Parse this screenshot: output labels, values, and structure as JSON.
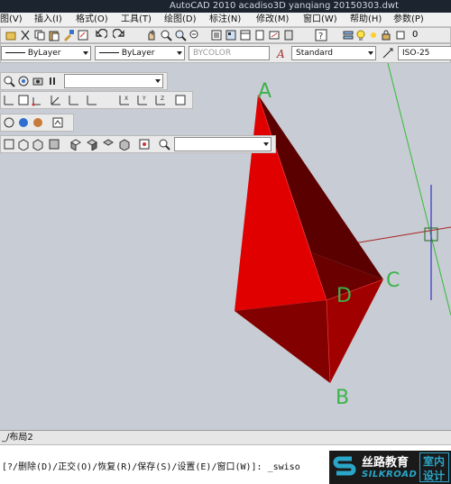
{
  "titlebar": {
    "title": "AutoCAD 2010    acadiso3D  yanqiang 20150303.dwt"
  },
  "menu": [
    "图(V)",
    "插入(I)",
    "格式(O)",
    "工具(T)",
    "绘图(D)",
    "标注(N)",
    "修改(M)",
    "窗口(W)",
    "帮助(H)",
    "参数(P)"
  ],
  "properties": {
    "linetype": "ByLayer",
    "lineweight": "ByLayer",
    "color": "BYCOLOR",
    "text_style": "Standard",
    "dim_style": "ISO-25",
    "layer_value": "0"
  },
  "points": {
    "a": "A",
    "b": "B",
    "c": "C",
    "d": "D"
  },
  "colors": {
    "face_light": "#e00000",
    "face_mid": "#a00000",
    "face_dark": "#6a0000",
    "label": "#3cb34a",
    "axis_y": "#3333cc",
    "axis_z": "#33bb33"
  },
  "tabs": {
    "layout2": "_/布局2"
  },
  "command": {
    "text": "[?/删除(D)/正交(O)/恢复(R)/保存(S)/设置(E)/窗口(W)]: _swiso"
  },
  "brand": {
    "cn": "丝路教育",
    "en": "SILKROAD",
    "box_top": "室内",
    "box_bottom": "设计"
  }
}
